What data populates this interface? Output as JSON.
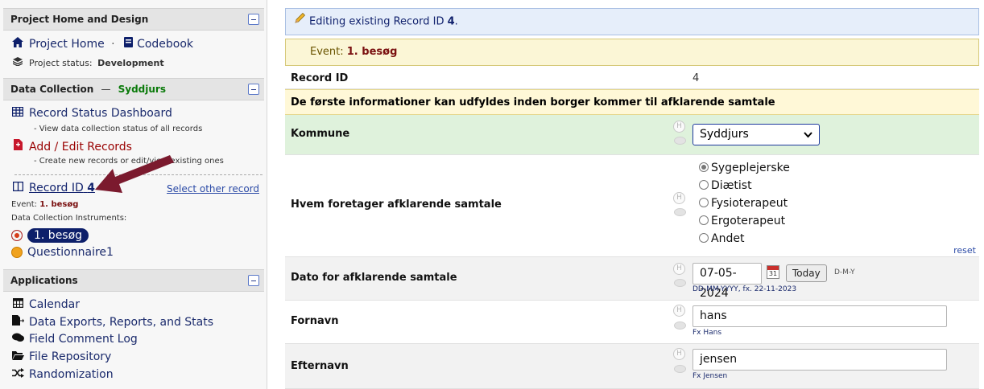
{
  "sidebar": {
    "project_home": {
      "header": "Project Home and Design",
      "project_home_link": "Project Home",
      "separator": "·",
      "codebook_link": "Codebook",
      "status_label": "Project status:",
      "status_value": "Development"
    },
    "data_collection": {
      "header": "Data Collection",
      "dash": "—",
      "site": "Syddjurs",
      "record_status_dashboard": "Record Status Dashboard",
      "record_status_desc": "- View data collection status of all records",
      "add_edit_records": "Add / Edit Records",
      "add_edit_desc": "- Create new records or edit/view existing ones",
      "record_label": "Record ID",
      "record_id": "4",
      "select_other": "Select other record",
      "event_label": "Event:",
      "event_value": "1. besøg",
      "instruments_label": "Data Collection Instruments:",
      "instruments": [
        {
          "name": "1. besøg",
          "status": "incomplete",
          "selected": true
        },
        {
          "name": "Questionnaire1",
          "status": "unverified",
          "selected": false
        }
      ]
    },
    "applications": {
      "header": "Applications",
      "items": [
        {
          "label": "Calendar",
          "icon": "calendar-icon"
        },
        {
          "label": "Data Exports, Reports, and Stats",
          "icon": "export-icon"
        },
        {
          "label": "Field Comment Log",
          "icon": "comments-icon"
        },
        {
          "label": "File Repository",
          "icon": "folder-icon"
        },
        {
          "label": "Randomization",
          "icon": "shuffle-icon"
        }
      ]
    }
  },
  "main": {
    "edit_banner": {
      "prefix": "Editing existing Record ID",
      "record_id": "4",
      "suffix": "."
    },
    "event_banner": {
      "label": "Event:",
      "value": "1. besøg"
    },
    "record_id_row": {
      "label": "Record ID",
      "value": "4"
    },
    "section_header": "De første informationer kan udfyldes inden borger kommer til afklarende samtale",
    "kommune": {
      "label": "Kommune",
      "value": "Syddjurs"
    },
    "hvem": {
      "label": "Hvem foretager afklarende samtale",
      "options": [
        "Sygeplejerske",
        "Diætist",
        "Fysioterapeut",
        "Ergoterapeut",
        "Andet"
      ],
      "selected_index": 0,
      "reset": "reset"
    },
    "dato": {
      "label": "Dato for afklarende samtale",
      "value": "07-05-2024",
      "today": "Today",
      "format": "D-M-Y",
      "hint": "DD-MM-YYYY, fx. 22-11-2023",
      "cal_day": "31"
    },
    "fornavn": {
      "label": "Fornavn",
      "value": "hans",
      "hint": "Fx Hans"
    },
    "efternavn": {
      "label": "Efternavn",
      "value": "jensen",
      "hint": "Fx Jensen"
    },
    "field_badge": "H"
  },
  "colors": {
    "link_dark": "#12236e",
    "accent_green": "#0a7a0a",
    "banner_blue": "#e6eefa",
    "banner_yellow": "#fbf6d6",
    "row_green": "#dff2dc",
    "arrow": "#7b1a2e"
  }
}
